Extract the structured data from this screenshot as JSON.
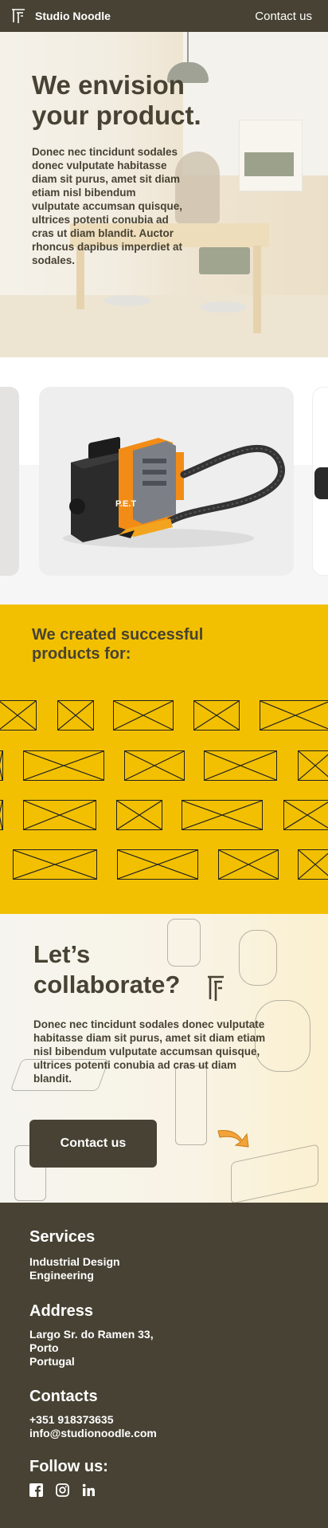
{
  "nav": {
    "brand_name": "Studio Noodle",
    "contact_label": "Contact us",
    "logo_icon": "studio-noodle-logo"
  },
  "hero": {
    "title": "We envision your product.",
    "text": "Donec nec tincidunt sodales donec vulputate habitasse diam sit purus, amet sit diam etiam nisl bibendum vulputate accumsan quisque, ultrices potenti conubia ad cras ut diam blandit. Auctor rhoncus dapibus imperdiet at sodales."
  },
  "gallery": {
    "product_label": "P.E.T"
  },
  "clients": {
    "title": "We created successful products for:"
  },
  "collab": {
    "title": "Let’s collaborate?",
    "text": "Donec nec tincidunt sodales donec vulputate habitasse diam sit purus, amet sit diam etiam nisl bibendum vulputate accumsan quisque, ultrices potenti conubia ad cras ut diam blandit.",
    "button_label": "Contact us"
  },
  "footer": {
    "services_heading": "Services",
    "services": [
      "Industrial Design",
      "Engineering"
    ],
    "address_heading": "Address",
    "address_lines": [
      "Largo Sr. do Ramen  33,",
      "Porto",
      "Portugal"
    ],
    "contacts_heading": "Contacts",
    "phone": "+351 918373635",
    "email": "info@studionoodle.com",
    "follow_heading": "Follow us:",
    "social_icons": [
      "facebook-icon",
      "instagram-icon",
      "linkedin-icon"
    ]
  },
  "colors": {
    "dark": "#474233",
    "yellow": "#f2c000",
    "white": "#ffffff"
  }
}
